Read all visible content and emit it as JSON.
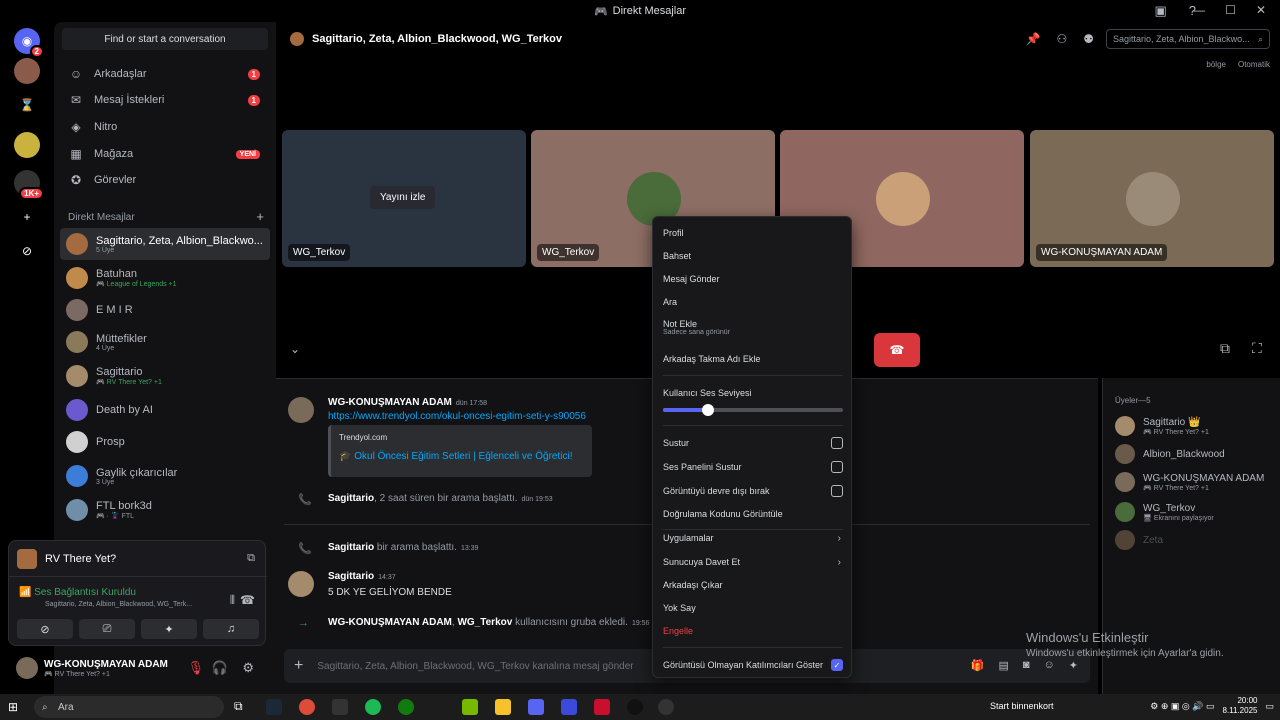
{
  "window": {
    "title": "Direkt Mesajlar"
  },
  "dm_column": {
    "find_placeholder": "Find or start a conversation",
    "nav": [
      {
        "label": "Arkadaşlar",
        "count": "1"
      },
      {
        "label": "Mesaj İstekleri",
        "count": "1"
      },
      {
        "label": "Nitro"
      },
      {
        "label": "Mağaza",
        "badge": "YENİ"
      },
      {
        "label": "Görevler"
      }
    ],
    "section_header": "Direkt Mesajlar",
    "dms": [
      {
        "name": "Sagittario, Zeta, Albion_Blackwo...",
        "sub": "5 Üye"
      },
      {
        "name": "Batuhan",
        "sub": "🎮 League of Legends +1"
      },
      {
        "name": "E M I R",
        "sub": ""
      },
      {
        "name": "Müttefikler",
        "sub": "4 Üye"
      },
      {
        "name": "Sagittario",
        "sub": "🎮 RV There Yet? +1"
      },
      {
        "name": "Death by AI",
        "sub": ""
      },
      {
        "name": "Prosp",
        "sub": ""
      },
      {
        "name": "Gaylik çıkarıcılar",
        "sub": "3 Üye"
      },
      {
        "name": "FTL bork3d",
        "sub": "🎮 · 🦹 FTL"
      }
    ]
  },
  "voice_panel": {
    "activity": "RV There Yet?",
    "status": "Ses Bağlantısı Kuruldu",
    "channel": "Sagittario, Zeta, Albion_Blackwood, WG_Terk..."
  },
  "user": {
    "name": "WG-KONUŞMAYAN ADAM",
    "status": "🎮 RV There Yet? +1"
  },
  "header": {
    "title": "Sagittario, Zeta, Albion_Blackwood, WG_Terkov",
    "search_placeholder": "Sagittario, Zeta, Albion_Blackwo...",
    "region_label": "bölge",
    "region_value": "Otomatik"
  },
  "tiles": [
    {
      "label": "WG_Terkov",
      "watch": "Yayını izle"
    },
    {
      "label": "WG_Terkov"
    },
    {
      "label": ""
    },
    {
      "label": "WG-KONUŞMAYAN ADAM"
    }
  ],
  "chat": {
    "msg1": {
      "author": "WG-KONUŞMAYAN ADAM",
      "time": "dün 17:58",
      "link": "https://www.trendyol.com/okul-oncesi-egitim-seti-y-s90056",
      "embed_provider": "Trendyol.com",
      "embed_title": "Okul Öncesi Eğitim Setleri | Eğlenceli ve Öğretici!"
    },
    "sys1": {
      "who": "Sagittario",
      "text": ", 2 saat süren bir arama başlattı.",
      "time": "dün 19:53"
    },
    "sys2": {
      "who": "Sagittario",
      "text": " bir arama başlattı.",
      "time": "13:39"
    },
    "msg2": {
      "author": "Sagittario",
      "time": "14:37",
      "text": "5 DK YE GELİYOM BENDE"
    },
    "sys3": {
      "who": "WG-KONUŞMAYAN ADAM",
      "mid": ", ",
      "who2": "WG_Terkov",
      "text": " kullanıcısını gruba ekledi.",
      "time": "19:56"
    },
    "composer_placeholder": "Sagittario, Zeta, Albion_Blackwood, WG_Terkov kanalına mesaj gönder"
  },
  "members": {
    "header": "Üyeler—5",
    "list": [
      {
        "name": "Sagittario 👑",
        "status": "🎮 RV There Yet? +1"
      },
      {
        "name": "Albion_Blackwood",
        "status": ""
      },
      {
        "name": "WG-KONUŞMAYAN ADAM",
        "status": "🎮 RV There Yet? +1"
      },
      {
        "name": "WG_Terkov",
        "status": "🖥 Ekranını paylaşıyor"
      },
      {
        "name": "Zeta",
        "status": ""
      }
    ]
  },
  "context_menu": {
    "items": [
      "Profil",
      "Bahset",
      "Mesaj Gönder",
      "Ara",
      "Not Ekle",
      "Arkadaş Takma Adı Ekle"
    ],
    "note_sub": "Sadece sana görünür",
    "volume_label": "Kullanıcı Ses Seviyesi",
    "volume_value": 0.25,
    "toggles": [
      "Sustur",
      "Ses Panelini Sustur",
      "Görüntüyü devre dışı bırak"
    ],
    "verify": "Doğrulama Kodunu Görüntüle",
    "apps": "Uygulamalar",
    "invite": "Sunucuya Davet Et",
    "remove_friend": "Arkadaşı Çıkar",
    "ignore": "Yok Say",
    "block": "Engelle",
    "show_nonvideo": "Görüntüsü Olmayan Katılımcıları Göster"
  },
  "watermark": {
    "line1": "Windows'u Etkinleştir",
    "line2": "Windows'u etkinleştirmek için Ayarlar'a gidin."
  },
  "taskbar": {
    "search": "Ara",
    "notification": "Start binnenkort",
    "time": "20:00",
    "date": "8.11.2025"
  }
}
